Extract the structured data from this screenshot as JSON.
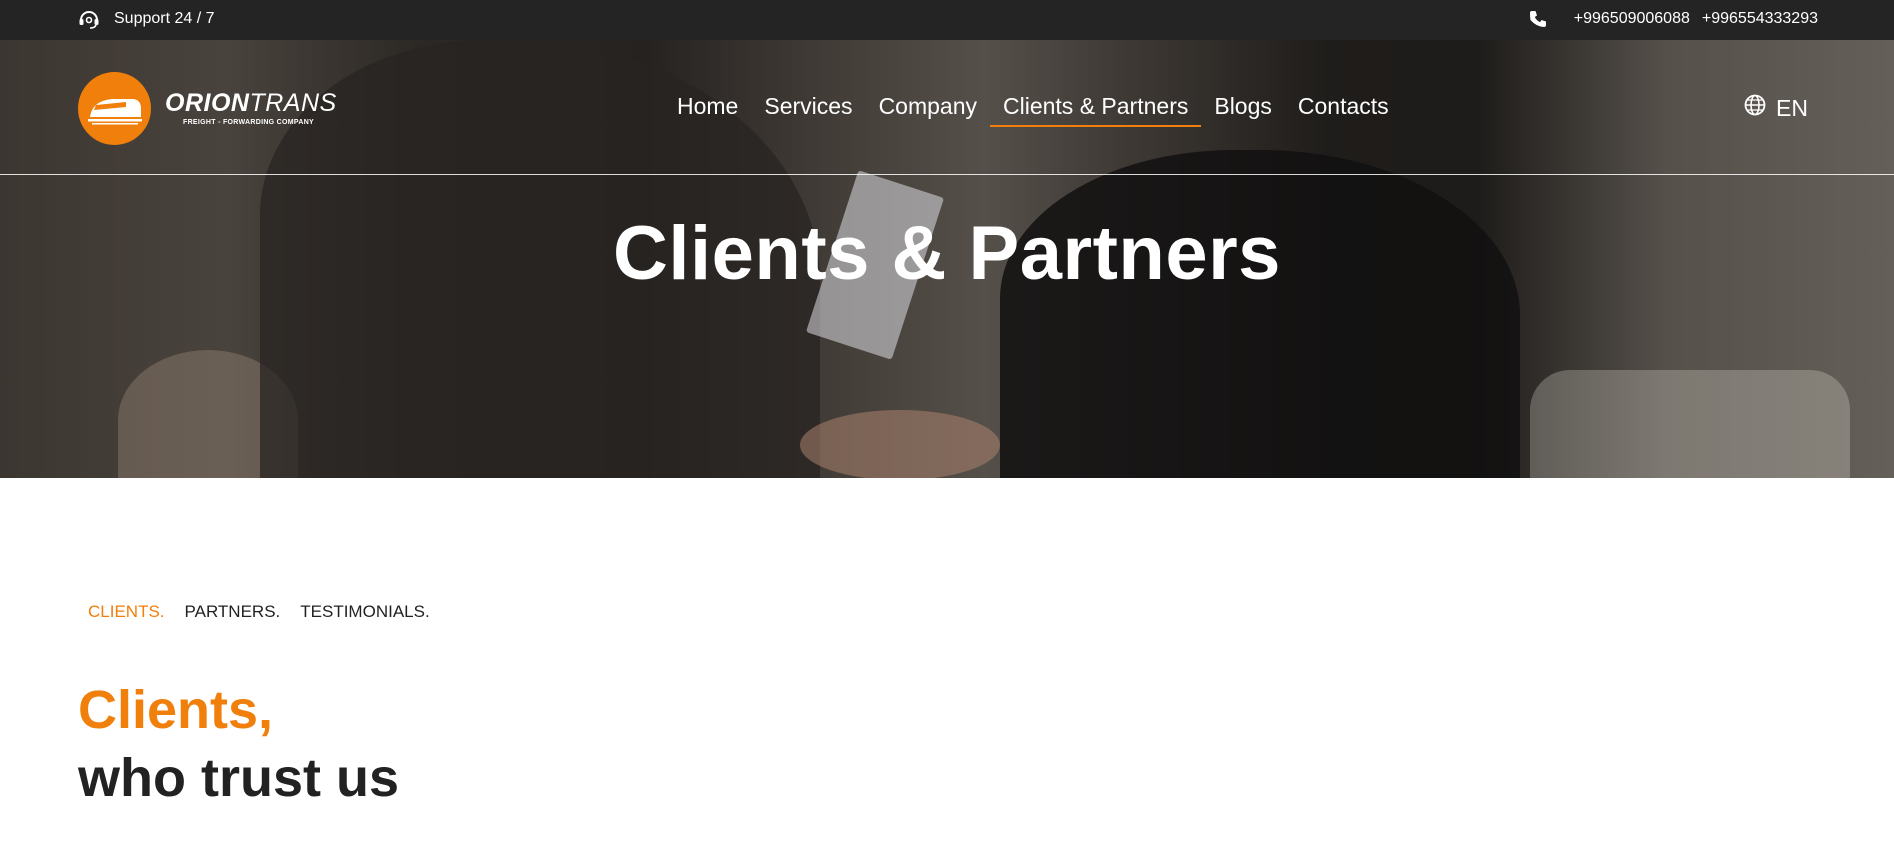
{
  "topbar": {
    "support_label": "Support 24 / 7",
    "phones": [
      "+996509006088",
      "+996554333293"
    ]
  },
  "logo": {
    "brand_bold": "ORION",
    "brand_light": "TRANS",
    "tagline": "FREIGHT - FORWARDING COMPANY"
  },
  "nav": {
    "items": [
      {
        "label": "Home"
      },
      {
        "label": "Services"
      },
      {
        "label": "Company"
      },
      {
        "label": "Clients & Partners",
        "active": true
      },
      {
        "label": "Blogs"
      },
      {
        "label": "Contacts"
      }
    ]
  },
  "language": {
    "current": "EN",
    "icon": "globe-icon"
  },
  "hero": {
    "title": "Clients & Partners"
  },
  "section_tabs": {
    "items": [
      {
        "label": "CLIENTS.",
        "active": true
      },
      {
        "label": "PARTNERS."
      },
      {
        "label": "TESTIMONIALS."
      }
    ]
  },
  "section": {
    "heading_accent": "Clients,",
    "heading_rest": "who trust us"
  },
  "colors": {
    "accent": "#f07f0b",
    "topbar_bg": "#242424",
    "text_dark": "#222222"
  },
  "icons": {
    "support": "headset-icon",
    "phone": "phone-icon",
    "logo": "train-icon"
  }
}
